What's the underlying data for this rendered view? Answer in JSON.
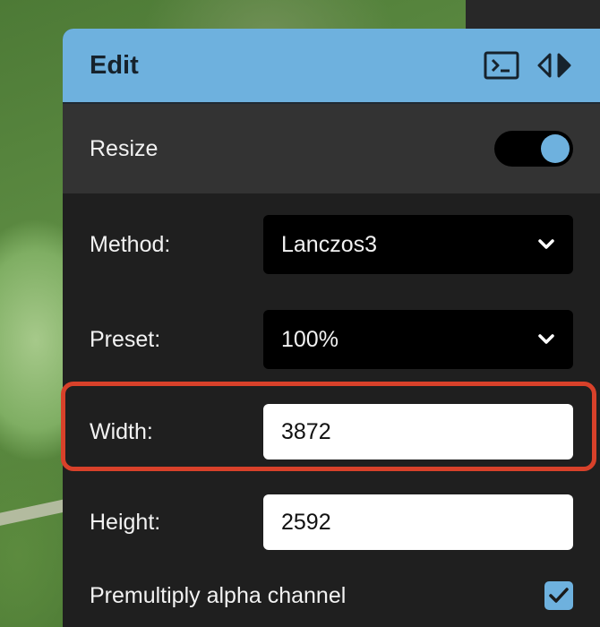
{
  "panel": {
    "title": "Edit",
    "terminal_icon": "terminal-icon",
    "swap_icon": "swap-arrows-icon"
  },
  "resize": {
    "label": "Resize",
    "enabled": true
  },
  "method": {
    "label": "Method:",
    "value": "Lanczos3"
  },
  "preset": {
    "label": "Preset:",
    "value": "100%"
  },
  "width": {
    "label": "Width:",
    "value": "3872"
  },
  "height": {
    "label": "Height:",
    "value": "2592"
  },
  "premultiply": {
    "label": "Premultiply alpha channel",
    "checked": true
  },
  "colors": {
    "accent": "#6eb1de",
    "highlight": "#d8412a"
  }
}
